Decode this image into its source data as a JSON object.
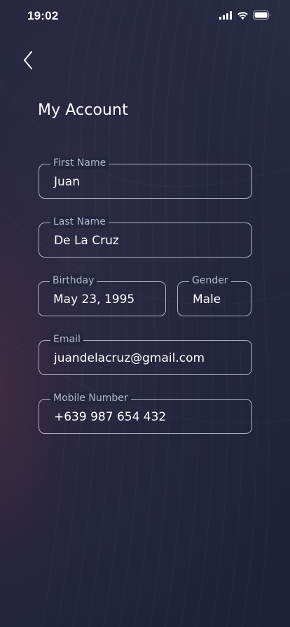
{
  "status_bar": {
    "time": "19:02",
    "icons": [
      "cellular-signal-icon",
      "wifi-icon",
      "battery-icon"
    ]
  },
  "header": {
    "back_icon": "chevron-left-icon",
    "title": "My Account"
  },
  "form": {
    "first_name": {
      "label": "First Name",
      "value": "Juan"
    },
    "last_name": {
      "label": "Last Name",
      "value": "De La Cruz"
    },
    "birthday": {
      "label": "Birthday",
      "value": "May 23, 1995"
    },
    "gender": {
      "label": "Gender",
      "value": "Male"
    },
    "email": {
      "label": "Email",
      "value": "juandelacruz@gmail.com"
    },
    "mobile": {
      "label": "Mobile Number",
      "value": "+639 987 654 432"
    }
  },
  "colors": {
    "background": "#1c1f33",
    "field_border": "#dcdeeb",
    "label_text": "#b7b9c9",
    "value_text": "#ffffff"
  }
}
